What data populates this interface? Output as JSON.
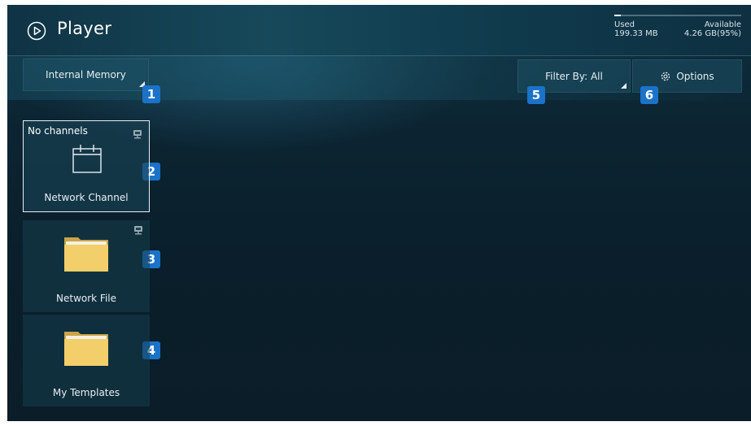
{
  "header": {
    "title": "Player",
    "storage": {
      "used_label": "Used",
      "used_value": "199.33 MB",
      "available_label": "Available",
      "available_value": "4.26 GB(95%)",
      "used_fraction": 0.05
    }
  },
  "toolbar": {
    "memory_dropdown": "Internal Memory",
    "filter_dropdown": "Filter By: All",
    "options_button": "Options"
  },
  "tiles": [
    {
      "label": "Network Channel",
      "status": "No channels",
      "icon": "calendar-icon",
      "network": true,
      "selected": true
    },
    {
      "label": "Network File",
      "status": "",
      "icon": "folder-icon",
      "network": true,
      "selected": false
    },
    {
      "label": "My Templates",
      "status": "",
      "icon": "folder-icon",
      "network": false,
      "selected": false
    }
  ],
  "callouts": [
    "1",
    "2",
    "3",
    "4",
    "5",
    "6"
  ],
  "colors": {
    "badge": "#1a73c9",
    "background": "#0c2432",
    "folder": "#f2cf6a"
  }
}
